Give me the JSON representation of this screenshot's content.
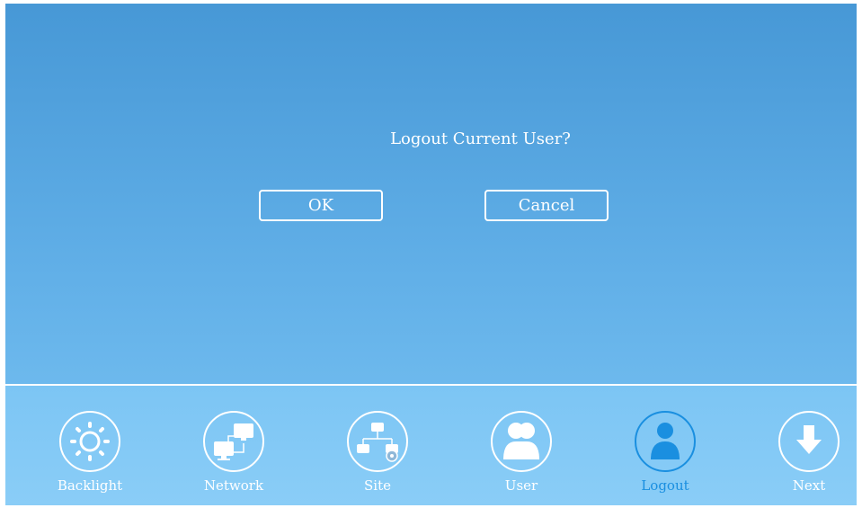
{
  "dialog": {
    "title": "Logout Current User?",
    "ok_label": "OK",
    "cancel_label": "Cancel"
  },
  "toolbar": {
    "items": [
      {
        "label": "Backlight",
        "icon": "sun-icon"
      },
      {
        "label": "Network",
        "icon": "network-icon"
      },
      {
        "label": "Site",
        "icon": "site-icon"
      },
      {
        "label": "User",
        "icon": "users-icon"
      },
      {
        "label": "Logout",
        "icon": "logout-user-icon"
      },
      {
        "label": "Next",
        "icon": "arrow-down-icon"
      }
    ],
    "active_index": 4
  },
  "colors": {
    "bg_top": "#4798d6",
    "bg_bottom": "#79c3f3",
    "active": "#1a8fe0"
  }
}
